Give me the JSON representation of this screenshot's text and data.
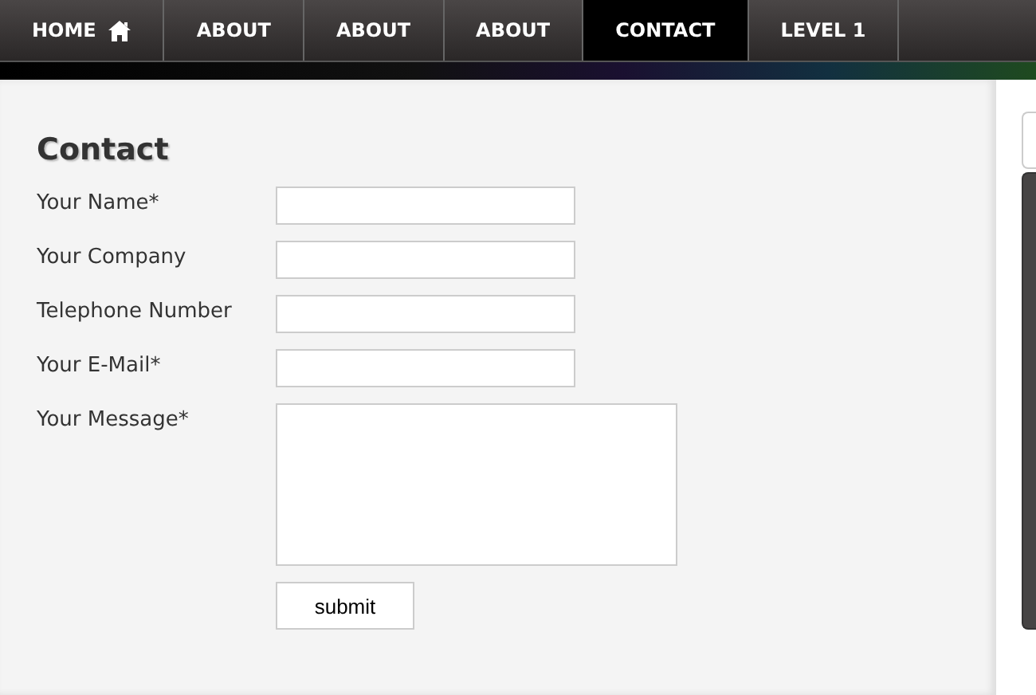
{
  "nav": [
    {
      "label": "HOME",
      "kind": "home",
      "selected": false
    },
    {
      "label": "ABOUT",
      "kind": "link",
      "selected": false
    },
    {
      "label": "ABOUT",
      "kind": "link",
      "selected": false
    },
    {
      "label": "ABOUT",
      "kind": "link",
      "selected": false
    },
    {
      "label": "CONTACT",
      "kind": "link",
      "selected": true
    },
    {
      "label": "LEVEL 1",
      "kind": "link",
      "selected": false
    }
  ],
  "heading": "Contact",
  "fields": [
    {
      "label": "Your Name*",
      "kind": "input"
    },
    {
      "label": "Your Company",
      "kind": "input"
    },
    {
      "label": "Telephone Number",
      "kind": "input"
    },
    {
      "label": "Your E-Mail*",
      "kind": "input"
    },
    {
      "label": "Your Message*",
      "kind": "textarea"
    }
  ],
  "submit": "submit"
}
